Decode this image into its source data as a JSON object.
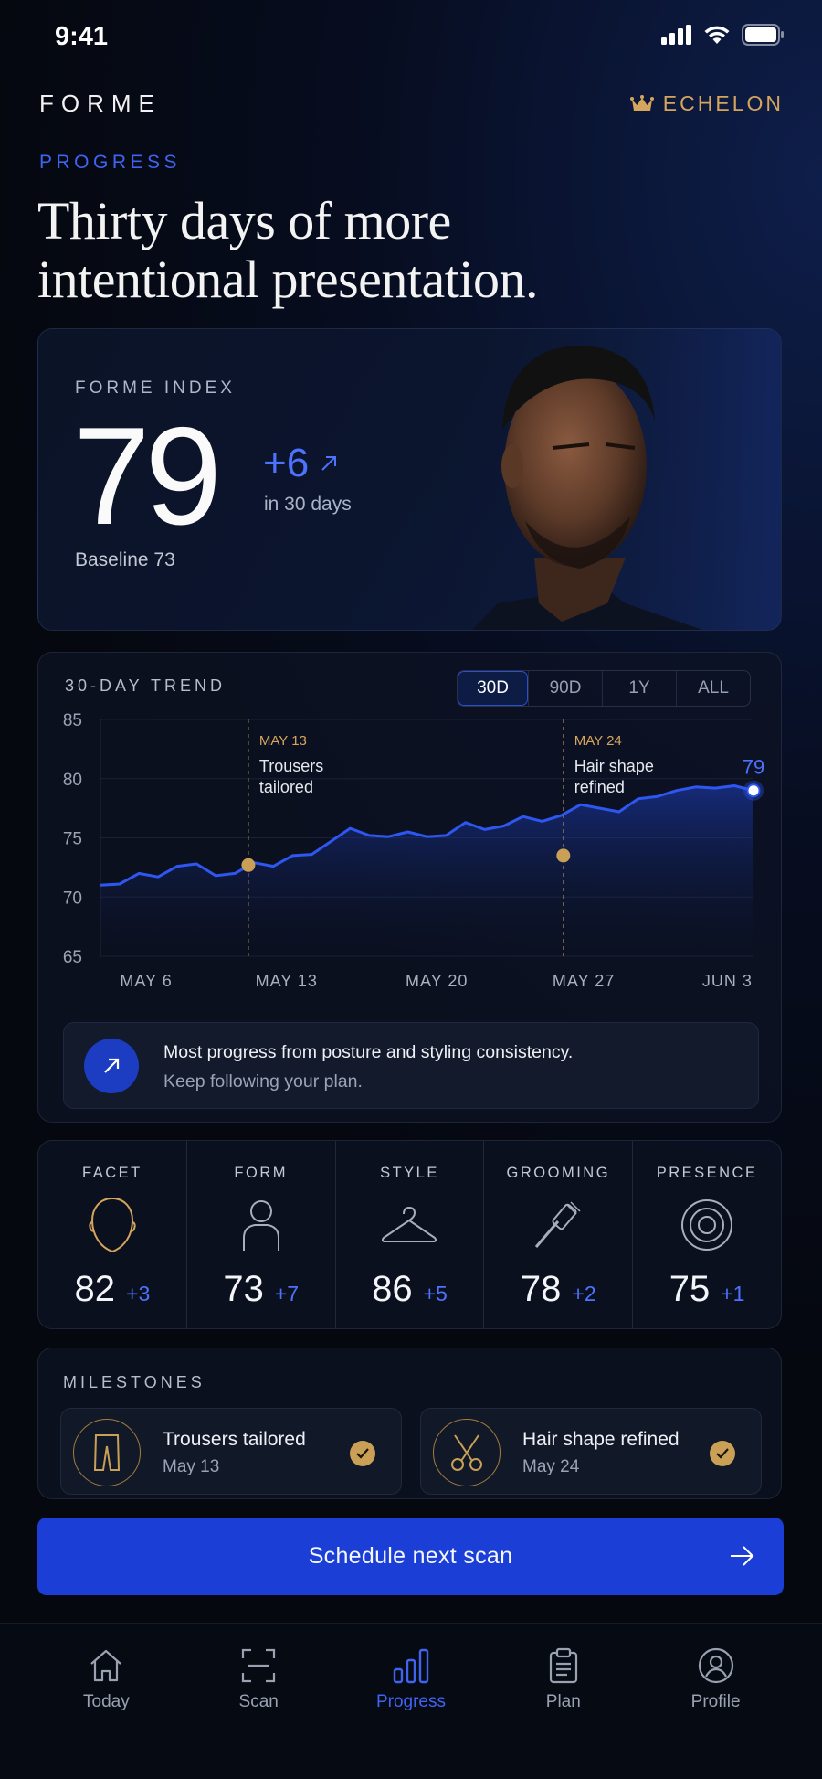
{
  "status_bar": {
    "time": "9:41"
  },
  "header": {
    "brand": "FORME",
    "tier": "ECHELON",
    "eyebrow": "PROGRESS",
    "headline_line1": "Thirty days of more",
    "headline_line2": "intentional presentation."
  },
  "index_card": {
    "label": "FORME INDEX",
    "score": "79",
    "delta": "+6",
    "delta_period": "in 30 days",
    "baseline": "Baseline 73"
  },
  "trend": {
    "label": "30-DAY TREND",
    "ranges": [
      "30D",
      "90D",
      "1Y",
      "ALL"
    ],
    "active_range": "30D",
    "insight_line1": "Most progress from posture and styling consistency.",
    "insight_line2": "Keep following your plan."
  },
  "chart_data": {
    "type": "line",
    "x_labels": [
      "MAY 6",
      "MAY 13",
      "MAY 20",
      "MAY 27",
      "JUN 3"
    ],
    "ylim": [
      65,
      85
    ],
    "yticks": [
      85,
      80,
      75,
      70,
      65
    ],
    "grid": true,
    "series": [
      {
        "values": [
          71.0,
          71.1,
          72.0,
          71.7,
          72.6,
          72.8,
          71.8,
          72.0,
          72.9,
          72.6,
          73.5,
          73.6,
          74.7,
          75.8,
          75.2,
          75.1,
          75.5,
          75.1,
          75.2,
          76.3,
          75.7,
          76.0,
          76.8,
          76.4,
          76.9,
          77.8,
          77.5,
          77.2,
          78.3,
          78.5,
          79.0,
          79.3,
          79.2,
          79.4,
          79.0
        ]
      }
    ],
    "end_label": "79",
    "annotations": [
      {
        "date": "MAY 13",
        "text_line1": "Trousers",
        "text_line2": "tailored",
        "index": 10,
        "value": 72.7
      },
      {
        "date": "MAY 24",
        "text_line1": "Hair shape",
        "text_line2": "refined",
        "index": 29,
        "value": 73.5
      }
    ]
  },
  "facets": [
    {
      "label": "FACET",
      "value": "82",
      "delta": "+3",
      "icon": "face-icon"
    },
    {
      "label": "FORM",
      "value": "73",
      "delta": "+7",
      "icon": "body-icon"
    },
    {
      "label": "STYLE",
      "value": "86",
      "delta": "+5",
      "icon": "hanger-icon"
    },
    {
      "label": "GROOMING",
      "value": "78",
      "delta": "+2",
      "icon": "brush-icon"
    },
    {
      "label": "PRESENCE",
      "value": "75",
      "delta": "+1",
      "icon": "target-icon"
    }
  ],
  "milestones": {
    "label": "MILESTONES",
    "items": [
      {
        "title": "Trousers tailored",
        "date": "May 13",
        "icon": "trousers-icon"
      },
      {
        "title": "Hair shape refined",
        "date": "May 24",
        "icon": "scissors-icon"
      }
    ]
  },
  "cta": {
    "label": "Schedule next scan"
  },
  "tabs": [
    {
      "label": "Today",
      "icon": "home-icon"
    },
    {
      "label": "Scan",
      "icon": "scan-icon"
    },
    {
      "label": "Progress",
      "icon": "bar-chart-icon",
      "active": true
    },
    {
      "label": "Plan",
      "icon": "clipboard-icon"
    },
    {
      "label": "Profile",
      "icon": "user-circle-icon"
    }
  ],
  "colors": {
    "accent": "#3f64f2",
    "gold": "#d6a55d",
    "bg": "#070d20",
    "cta": "#1b3fd6"
  }
}
